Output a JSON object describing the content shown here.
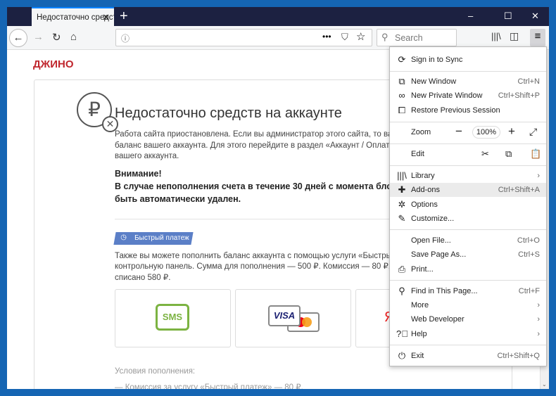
{
  "browser": {
    "tab_title": "Недостаточно средств на аккаунте",
    "search_placeholder": "Search",
    "window_controls": {
      "minimize": "–",
      "maximize": "☐",
      "close": "✕"
    }
  },
  "page": {
    "logo": "ДЖИНО",
    "title": "Недостаточно средств на аккаунте",
    "intro": [
      "Работа сайта приостановлена. Если вы администратор этого сайта, то вам не",
      "баланс вашего аккаунта. Для этого перейдите в раздел «Аккаунт / Оплата» к",
      "вашего аккаунта."
    ],
    "warning_title": "Внимание!",
    "warning": [
      "В случае непополнения счета в течение 30 дней с момента блокир",
      "быть автоматически удален."
    ],
    "badge": "Быстрый платеж",
    "quick_text": [
      "Также вы можете пополнить баланс аккаунта с помощью услуги «Быстрый пл",
      "контрольную панель. Сумма для пополнения — 500 ₽. Комиссия — 80 ₽, с ва",
      "списано 580 ₽."
    ],
    "options": {
      "sms": "SMS",
      "visa": "VISA",
      "yandex": "Я"
    },
    "conditions_title": "Условия пополнения:",
    "conditions": [
      "—  Комиссия за услугу «Быстрый платеж» — 80 ₽."
    ]
  },
  "menu": {
    "sync": "Sign in to Sync",
    "new_window": {
      "label": "New Window",
      "shortcut": "Ctrl+N"
    },
    "private": {
      "label": "New Private Window",
      "shortcut": "Ctrl+Shift+P"
    },
    "restore": {
      "label": "Restore Previous Session"
    },
    "zoom": {
      "label": "Zoom",
      "value": "100%"
    },
    "edit": {
      "label": "Edit"
    },
    "library": {
      "label": "Library"
    },
    "addons": {
      "label": "Add-ons",
      "shortcut": "Ctrl+Shift+A"
    },
    "options": {
      "label": "Options"
    },
    "customize": {
      "label": "Customize..."
    },
    "open_file": {
      "label": "Open File...",
      "shortcut": "Ctrl+O"
    },
    "save_page": {
      "label": "Save Page As...",
      "shortcut": "Ctrl+S"
    },
    "print": {
      "label": "Print..."
    },
    "find": {
      "label": "Find in This Page...",
      "shortcut": "Ctrl+F"
    },
    "more": {
      "label": "More"
    },
    "webdev": {
      "label": "Web Developer"
    },
    "help": {
      "label": "Help"
    },
    "exit": {
      "label": "Exit",
      "shortcut": "Ctrl+Shift+Q"
    }
  }
}
